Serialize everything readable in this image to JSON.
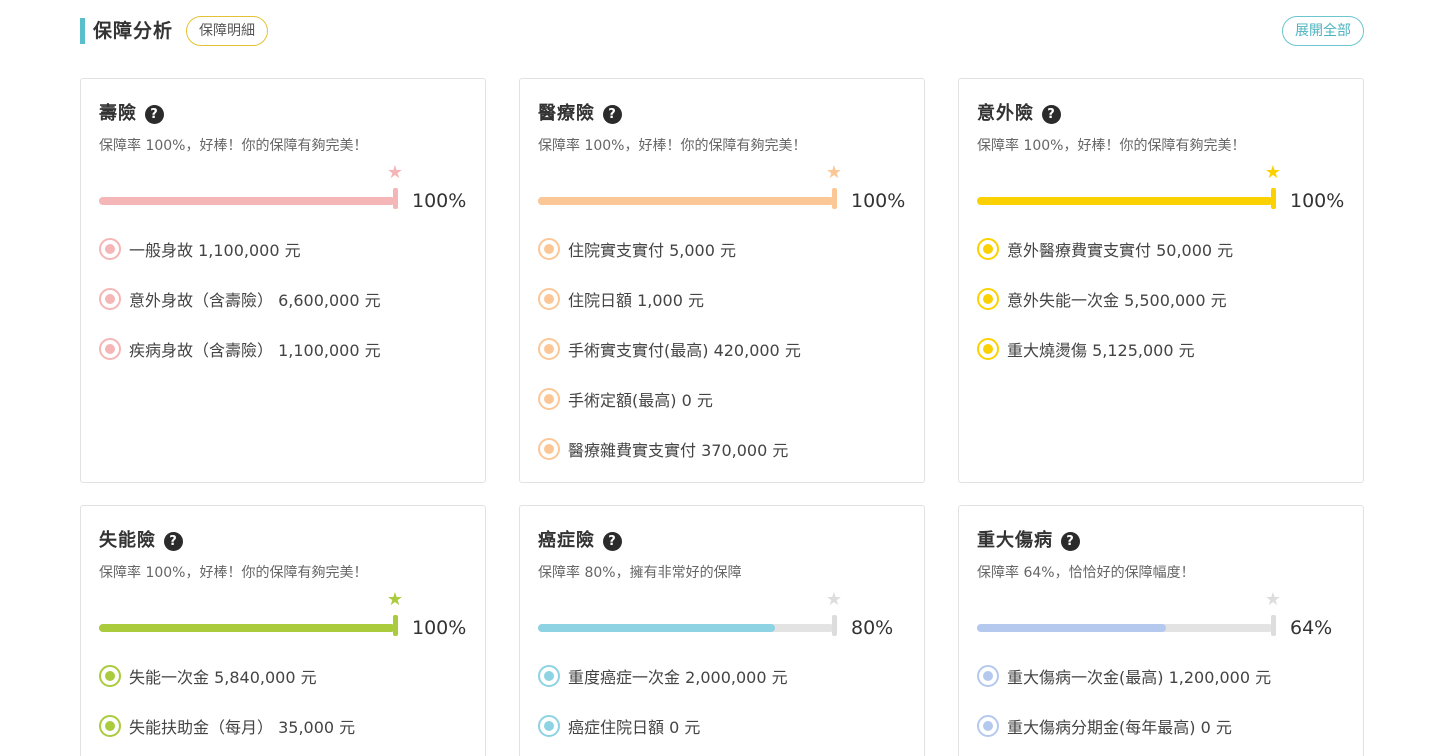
{
  "header": {
    "title": "保障分析",
    "detail_button": "保障明細",
    "expand_button": "展開全部"
  },
  "cards": [
    {
      "title": "壽險",
      "desc": "保障率 100%，好棒！你的保障有夠完美！",
      "percent": 100,
      "percent_label": "100%",
      "color": "#f4b6b6",
      "star_color": "#f4b6b6",
      "items": [
        "一般身故 1,100,000 元",
        "意外身故（含壽險） 6,600,000 元",
        "疾病身故（含壽險） 1,100,000 元"
      ]
    },
    {
      "title": "醫療險",
      "desc": "保障率 100%，好棒！你的保障有夠完美！",
      "percent": 100,
      "percent_label": "100%",
      "color": "#fbc797",
      "star_color": "#fbc797",
      "items": [
        "住院實支實付 5,000 元",
        "住院日額 1,000 元",
        "手術實支實付(最高) 420,000 元",
        "手術定額(最高) 0 元",
        "醫療雜費實支實付 370,000 元"
      ]
    },
    {
      "title": "意外險",
      "desc": "保障率 100%，好棒！你的保障有夠完美！",
      "percent": 100,
      "percent_label": "100%",
      "color": "#fcd102",
      "star_color": "#fcd102",
      "items": [
        "意外醫療費實支實付 50,000 元",
        "意外失能一次金 5,500,000 元",
        "重大燒燙傷 5,125,000 元"
      ]
    },
    {
      "title": "失能險",
      "desc": "保障率 100%，好棒！你的保障有夠完美！",
      "percent": 100,
      "percent_label": "100%",
      "color": "#a9cb3c",
      "star_color": "#a9cb3c",
      "items": [
        "失能一次金 5,840,000 元",
        "失能扶助金（每月） 35,000 元"
      ]
    },
    {
      "title": "癌症險",
      "desc": "保障率 80%，擁有非常好的保障",
      "percent": 80,
      "percent_label": "80%",
      "color": "#8dd3e3",
      "star_color": "#dddddd",
      "items": [
        "重度癌症一次金 2,000,000 元",
        "癌症住院日額 0 元"
      ]
    },
    {
      "title": "重大傷病",
      "desc": "保障率 64%，恰恰好的保障幅度！",
      "percent": 64,
      "percent_label": "64%",
      "color": "#b5c9ef",
      "star_color": "#dddddd",
      "items": [
        "重大傷病一次金(最高) 1,200,000 元",
        "重大傷病分期金(每年最高) 0 元"
      ]
    }
  ]
}
